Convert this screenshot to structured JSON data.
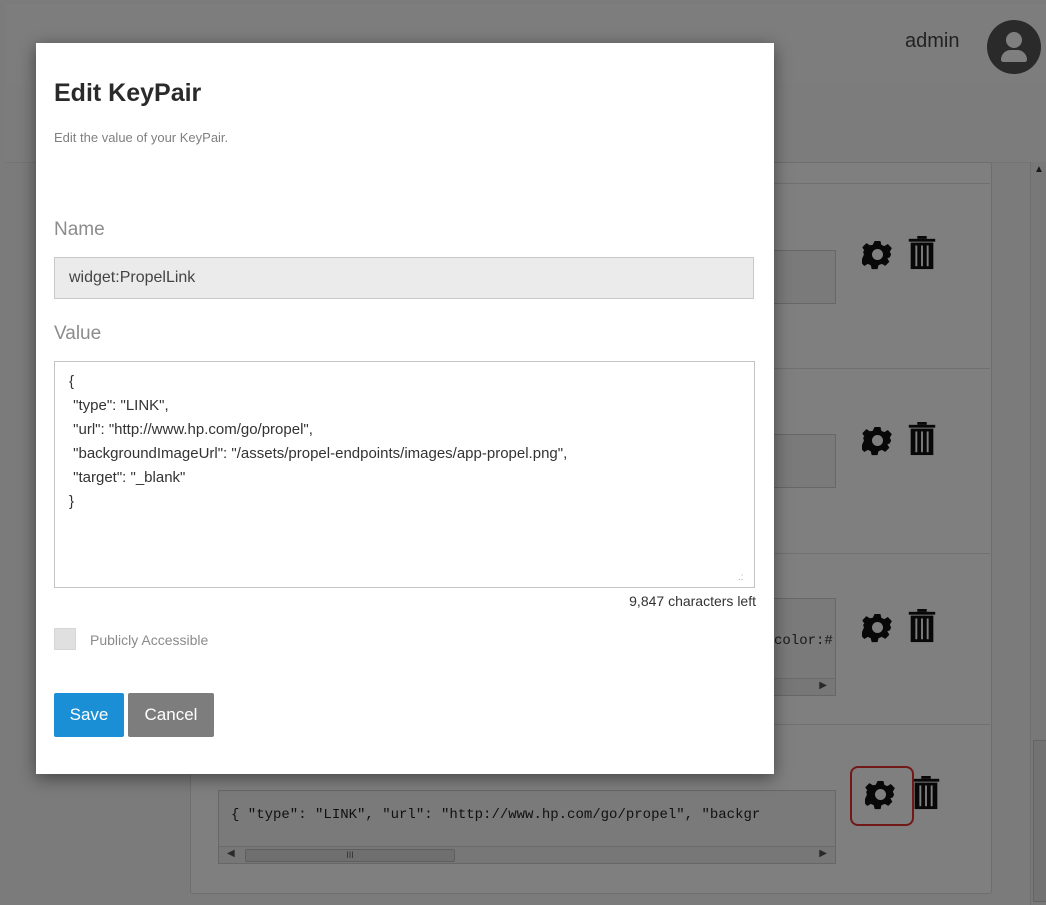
{
  "header": {
    "user_name": "admin"
  },
  "modal": {
    "title": "Edit KeyPair",
    "subtitle": "Edit the value of your KeyPair.",
    "name_label": "Name",
    "name_value": "widget:PropelLink",
    "value_label": "Value",
    "value_text": "{\n \"type\": \"LINK\",\n \"url\": \"http://www.hp.com/go/propel\",\n \"backgroundImageUrl\": \"/assets/propel-endpoints/images/app-propel.png\",\n \"target\": \"_blank\"\n}",
    "chars_left": "9,847 characters left",
    "public_label": "Publicly Accessible",
    "save_label": "Save",
    "cancel_label": "Cancel"
  },
  "background_rows": {
    "row3_snippet": "color:#",
    "row4_code": "{ \"type\": \"LINK\", \"url\": \"http://www.hp.com/go/propel\", \"backgr",
    "scroll_thumb_label": "III"
  },
  "colors": {
    "primary": "#1b8fd5",
    "secondary": "#7d7d7d",
    "focus_ring": "#e4302f"
  }
}
